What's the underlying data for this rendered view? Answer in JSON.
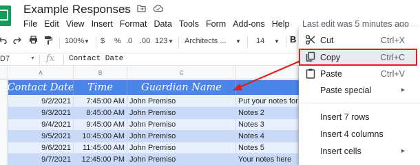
{
  "document": {
    "title": "Example Responses",
    "menus": [
      "File",
      "Edit",
      "View",
      "Insert",
      "Format",
      "Data",
      "Tools",
      "Form",
      "Add-ons",
      "Help"
    ],
    "last_edit": "Last edit was 5 minutes ago"
  },
  "toolbar": {
    "zoom": "100%",
    "currency": "$",
    "percent": "%",
    "dec_decrease": ".0",
    "dec_increase": ".00",
    "more_formats": "123",
    "font": "Architects ...",
    "font_size": "14",
    "bold": "B"
  },
  "formula_bar": {
    "cell_ref": "D7",
    "fx": "fx",
    "value": "Contact Date"
  },
  "sheet": {
    "columns": [
      "A",
      "B",
      "C"
    ],
    "header": [
      "Contact Date",
      "Time",
      "Guardian Name"
    ],
    "rows": [
      {
        "date": "9/2/2021",
        "time": "7:45:00 AM",
        "name": "John Premiso",
        "notes": "Put your notes for c"
      },
      {
        "date": "9/3/2021",
        "time": "8:45:00 AM",
        "name": "John Premiso",
        "notes": "Notes 2"
      },
      {
        "date": "9/4/2021",
        "time": "9:45:00 AM",
        "name": "John Premiso",
        "notes": "Notes 3"
      },
      {
        "date": "9/5/2021",
        "time": "10:45:00 AM",
        "name": "John Premiso",
        "notes": "Notes 4"
      },
      {
        "date": "9/6/2021",
        "time": "11:45:00 AM",
        "name": "John Premiso",
        "notes": "Notes 5"
      },
      {
        "date": "9/7/2021",
        "time": "12:45:00 PM",
        "name": "John Premiso",
        "notes": "Your notes here"
      }
    ]
  },
  "context_menu": {
    "items": [
      {
        "label": "Cut",
        "shortcut": "Ctrl+X",
        "icon": "scissors-icon"
      },
      {
        "label": "Copy",
        "shortcut": "Ctrl+C",
        "icon": "copy-icon"
      },
      {
        "label": "Paste",
        "shortcut": "Ctrl+V",
        "icon": "paste-icon"
      },
      {
        "label": "Paste special",
        "shortcut": "",
        "icon": ""
      },
      {
        "label": "Insert 7 rows",
        "shortcut": "",
        "icon": ""
      },
      {
        "label": "Insert 4 columns",
        "shortcut": "",
        "icon": ""
      },
      {
        "label": "Insert cells",
        "shortcut": "",
        "icon": ""
      }
    ],
    "submenu_arrow": "►"
  },
  "colors": {
    "header_fill": "#4a86e8",
    "row_band_a": "#e8f0fe",
    "row_band_b": "#c9daf8",
    "highlight_red": "#e0201b",
    "brand_green": "#0f9d58"
  }
}
